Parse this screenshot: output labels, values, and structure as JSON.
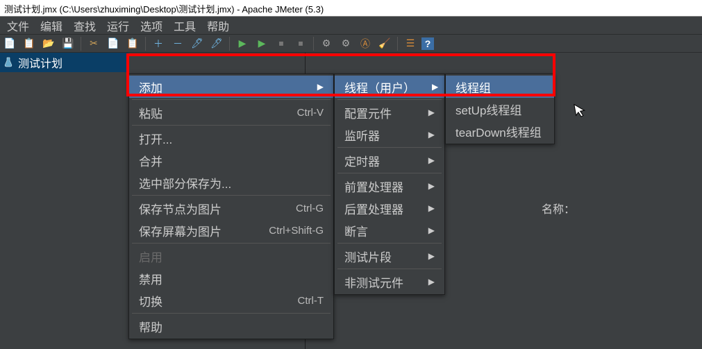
{
  "title": "测试计划.jmx (C:\\Users\\zhuximing\\Desktop\\测试计划.jmx) - Apache JMeter (5.3)",
  "menubar": {
    "items": [
      "文件",
      "编辑",
      "查找",
      "运行",
      "选项",
      "工具",
      "帮助"
    ]
  },
  "tree": {
    "root": "测试计划"
  },
  "content": {
    "name_label": "名称："
  },
  "ctx1": {
    "add": "添加",
    "paste": "粘贴",
    "paste_sc": "Ctrl-V",
    "open": "打开...",
    "merge": "合并",
    "save_selection": "选中部分保存为...",
    "save_node_img": "保存节点为图片",
    "save_node_img_sc": "Ctrl-G",
    "save_screen_img": "保存屏幕为图片",
    "save_screen_img_sc": "Ctrl+Shift-G",
    "enable": "启用",
    "disable": "禁用",
    "toggle": "切换",
    "toggle_sc": "Ctrl-T",
    "help": "帮助"
  },
  "ctx2": {
    "threads": "线程（用户）",
    "config": "配置元件",
    "listener": "监听器",
    "timer": "定时器",
    "preproc": "前置处理器",
    "postproc": "后置处理器",
    "assertion": "断言",
    "testfrag": "测试片段",
    "nontest": "非测试元件"
  },
  "ctx3": {
    "threadgroup": "线程组",
    "setup": "setUp线程组",
    "teardown": "tearDown线程组"
  },
  "icons": {
    "new": "📄",
    "tpl": "📋",
    "open": "📂",
    "save": "💾",
    "cut": "✂",
    "copy": "📄",
    "paste": "📋",
    "plus": "＋",
    "minus": "－",
    "wand": "🖊",
    "wand2": "🖊",
    "play": "▶",
    "play2": "▶",
    "stop": "⏹",
    "stop2": "⏹",
    "gear": "⚙",
    "gear2": "⚙",
    "a": "Ⓐ",
    "brush": "🧹",
    "list": "☰",
    "help": "?"
  }
}
